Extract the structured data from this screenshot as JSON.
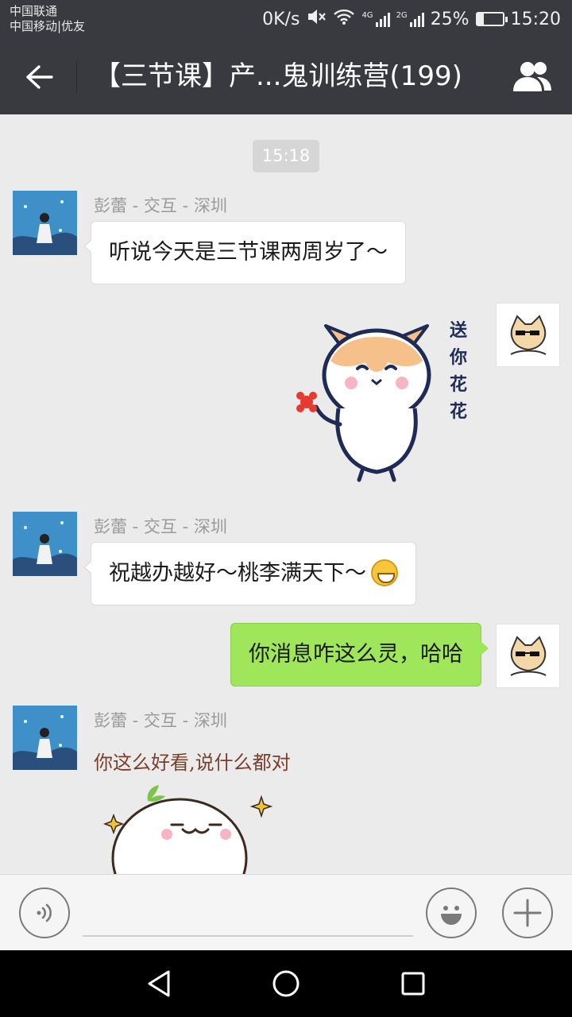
{
  "status_bar": {
    "carrier_1": "中国联通",
    "carrier_2": "中国移动|优友",
    "net_speed": "0K/s",
    "sig_1_tag": "4G",
    "sig_2_tag": "2G",
    "battery": "25%",
    "battery_level": 0.25,
    "time": "15:20"
  },
  "header": {
    "title": "【三节课】产...鬼训练营(199)",
    "back_icon": "arrow-left-icon",
    "group_icon": "group-members-icon"
  },
  "chat": {
    "timestamp": "15:18",
    "messages": [
      {
        "sender": "彭蕾 - 交互 - 深圳",
        "text": "听说今天是三节课两周岁了～"
      },
      {
        "sticker_text": [
          "送",
          "你",
          "花",
          "花"
        ]
      },
      {
        "sender": "彭蕾 - 交互 - 深圳",
        "text": "祝越办越好～桃李满天下～"
      },
      {
        "text": "你消息咋这么灵，哈哈"
      },
      {
        "sender": "彭蕾 - 交互 - 深圳",
        "sticker_caption": "你这么好看,说什么都对"
      }
    ]
  },
  "input_bar": {
    "voice_icon": "voice-icon",
    "emoji_icon": "emoji-icon",
    "plus_icon": "plus-icon",
    "input_value": ""
  },
  "nav_bar": {
    "back_icon": "nav-back-icon",
    "home_icon": "nav-home-icon",
    "recents_icon": "nav-recents-icon"
  },
  "colors": {
    "titlebar_bg": "#393a3f",
    "chat_bg": "#ebebeb",
    "outgoing_bubble": "#9fe65a",
    "incoming_bubble": "#ffffff"
  }
}
